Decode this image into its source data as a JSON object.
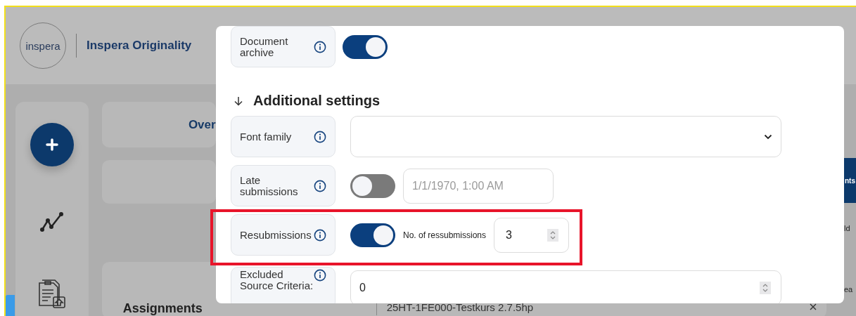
{
  "header": {
    "logo_text": "inspera",
    "app_name": "Inspera Originality"
  },
  "background": {
    "overview_tab": "Over",
    "right_button": "nts",
    "right_text_1": "ld",
    "right_text_2": "ea",
    "assignments_heading": "Assignments",
    "course_select": {
      "value": "25HT-1FE000-Testkurs 2.7.5hp"
    }
  },
  "dialog": {
    "settings": [
      {
        "kind": "toggle",
        "label": "Document archive",
        "on": true
      }
    ],
    "section": {
      "title": "Additional settings",
      "expanded": true
    },
    "additional": [
      {
        "kind": "select",
        "label": "Font family"
      },
      {
        "kind": "toggle_date",
        "label": "Late submissions",
        "on": false,
        "date": {
          "placeholder": "1/1/1970, 1:00 AM"
        }
      },
      {
        "kind": "toggle_number",
        "label": "Resubmissions",
        "on": true,
        "count_label": "No. of ressubmissions",
        "count": "3"
      },
      {
        "kind": "number",
        "label": "Excluded Source Criteria:",
        "value": "0"
      }
    ]
  }
}
